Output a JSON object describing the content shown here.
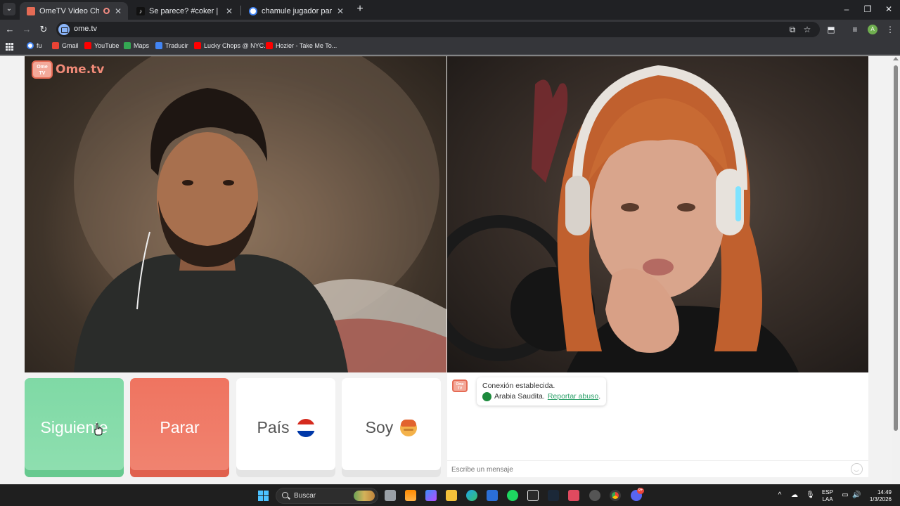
{
  "browser": {
    "tabs": [
      {
        "title": "OmeTV Video Chat — Ome",
        "active": true,
        "favicon_color": "#e56b55"
      },
      {
        "title": "Se parece? #coker | monte eve",
        "active": false,
        "favicon_color": "#111111"
      },
      {
        "title": "chamule jugador paraguayo - B",
        "active": false,
        "favicon_color": "#4285f4"
      }
    ],
    "url": "ome.tv",
    "bookmarks": [
      {
        "label": "fu",
        "color": "#4285f4"
      },
      {
        "label": "Gmail",
        "color": "#ea4335"
      },
      {
        "label": "YouTube",
        "color": "#ff0000"
      },
      {
        "label": "Maps",
        "color": "#34a853"
      },
      {
        "label": "Traducir",
        "color": "#4285f4"
      },
      {
        "label": "Lucky Chops @ NYC...",
        "color": "#ff0000"
      },
      {
        "label": "Hozier - Take Me To...",
        "color": "#ff0000"
      }
    ],
    "profile_initial": "A"
  },
  "page": {
    "logo_text": "Ome.tv",
    "logo_badge": "Ome TV",
    "controls": {
      "next_label": "Siguiente",
      "stop_label": "Parar",
      "country_label": "País",
      "gender_label": "Soy"
    },
    "chat": {
      "system_message": "Conexión establecida.",
      "country": "Arabia Saudita.",
      "report_link": "Reportar abuso",
      "report_suffix": ".",
      "input_placeholder": "Escribe un mensaje"
    },
    "colors": {
      "next": "#7fd9a5",
      "stop": "#ef7460",
      "brand": "#e56b55",
      "flag_paraguay": [
        "#d52b1e",
        "#ffffff",
        "#0038a8"
      ]
    }
  },
  "taskbar": {
    "search_placeholder": "Buscar",
    "lang_top": "ESP",
    "lang_bottom": "LAA",
    "time": "14:49",
    "date": "1/3/2026",
    "discord_badge": "9+"
  }
}
